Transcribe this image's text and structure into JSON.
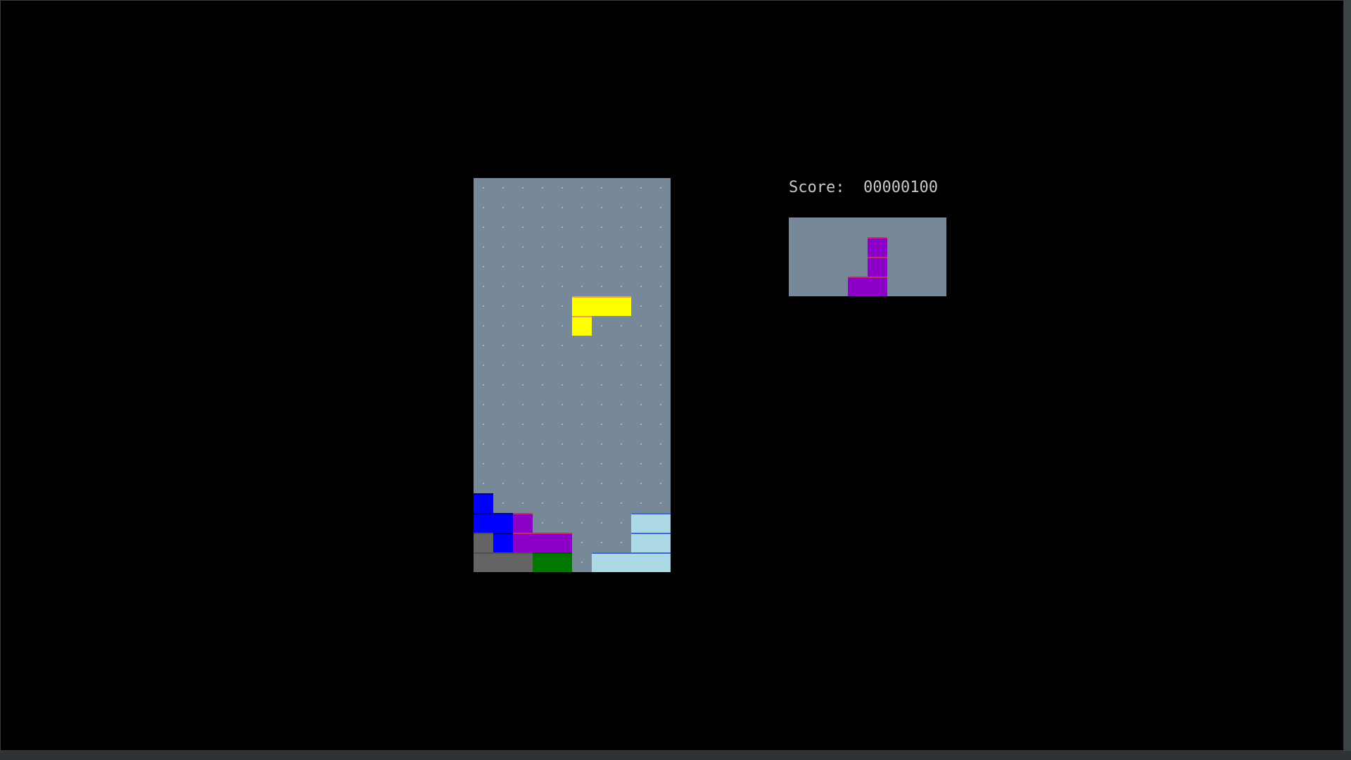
{
  "score": {
    "label": "Score:",
    "value": "00000100"
  },
  "board": {
    "cols": 10,
    "rows": 20,
    "locked_cells": [
      {
        "col": 0,
        "row": 16,
        "color": "#0000ff"
      },
      {
        "col": 0,
        "row": 17,
        "color": "#0000ff"
      },
      {
        "col": 1,
        "row": 17,
        "color": "#0000ff"
      },
      {
        "col": 1,
        "row": 18,
        "color": "#0000ff"
      },
      {
        "col": 2,
        "row": 17,
        "color": "#8c00c8"
      },
      {
        "col": 2,
        "row": 18,
        "color": "#8c00c8"
      },
      {
        "col": 3,
        "row": 18,
        "color": "#8c00c8"
      },
      {
        "col": 4,
        "row": 18,
        "color": "#8c00c8"
      },
      {
        "col": 0,
        "row": 18,
        "color": "#646464"
      },
      {
        "col": 0,
        "row": 19,
        "color": "#646464"
      },
      {
        "col": 1,
        "row": 19,
        "color": "#646464"
      },
      {
        "col": 2,
        "row": 19,
        "color": "#646464"
      },
      {
        "col": 3,
        "row": 19,
        "color": "#007800"
      },
      {
        "col": 4,
        "row": 19,
        "color": "#007800"
      },
      {
        "col": 8,
        "row": 17,
        "color": "#add8e6"
      },
      {
        "col": 9,
        "row": 17,
        "color": "#add8e6"
      },
      {
        "col": 8,
        "row": 18,
        "color": "#add8e6"
      },
      {
        "col": 9,
        "row": 18,
        "color": "#add8e6"
      },
      {
        "col": 6,
        "row": 19,
        "color": "#add8e6"
      },
      {
        "col": 7,
        "row": 19,
        "color": "#add8e6"
      },
      {
        "col": 8,
        "row": 19,
        "color": "#add8e6"
      },
      {
        "col": 9,
        "row": 19,
        "color": "#add8e6"
      }
    ],
    "active_piece": {
      "color": "#ffff00",
      "cells": [
        {
          "col": 5,
          "row": 6
        },
        {
          "col": 6,
          "row": 6
        },
        {
          "col": 7,
          "row": 6
        },
        {
          "col": 5,
          "row": 7
        }
      ]
    }
  },
  "next_piece": {
    "cols": 8,
    "rows": 4,
    "color": "#8c00c8",
    "cells": [
      {
        "col": 4,
        "row": 1
      },
      {
        "col": 4,
        "row": 2
      },
      {
        "col": 3,
        "row": 3
      },
      {
        "col": 4,
        "row": 3
      }
    ]
  }
}
